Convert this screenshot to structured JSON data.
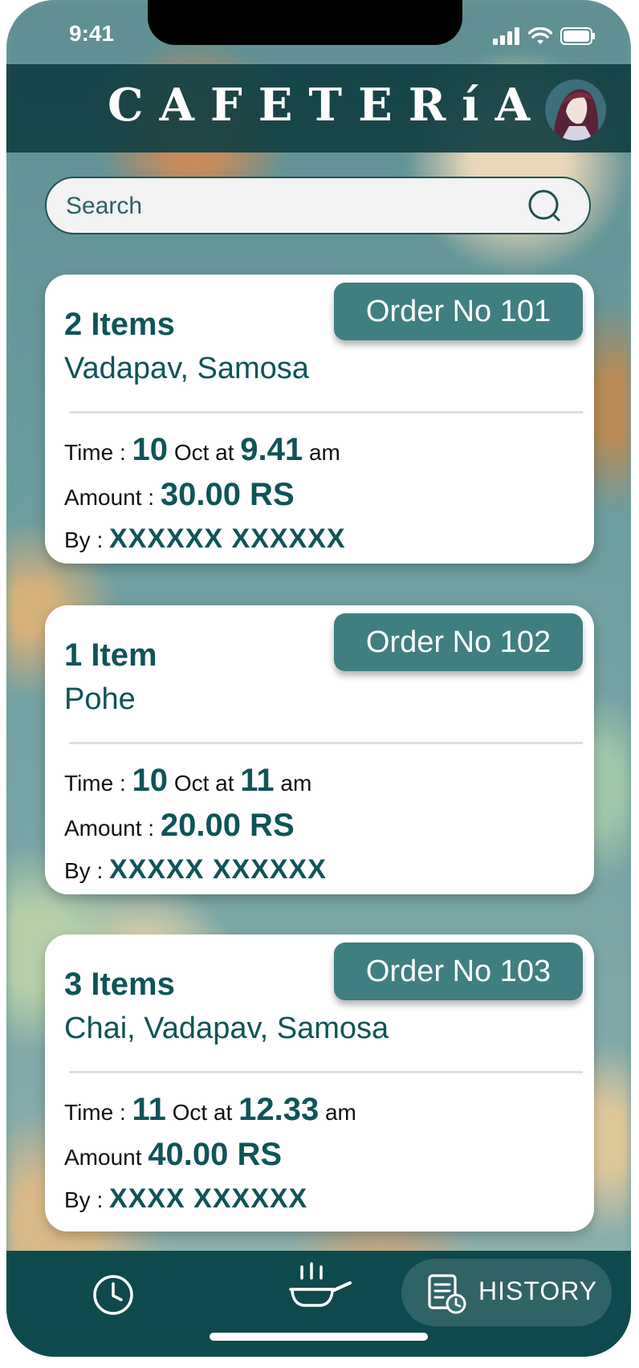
{
  "status_bar": {
    "time": "9:41"
  },
  "header": {
    "title": "CAFETERíA"
  },
  "search": {
    "placeholder": "Search"
  },
  "orders": [
    {
      "order_label": "Order No 101",
      "item_count": "2 Items",
      "items": "Vadapav, Samosa",
      "time_label": "Time :",
      "day": "10",
      "date_mid": "Oct at",
      "clock": "9.41",
      "period": "am",
      "amount_label": "Amount :",
      "amount": "30.00 RS",
      "by_label": "By :",
      "by": "XXXXXX XXXXXX"
    },
    {
      "order_label": "Order No 102",
      "item_count": "1 Item",
      "items": "Pohe",
      "time_label": "Time :",
      "day": "10",
      "date_mid": "Oct at",
      "clock": "11",
      "period": "am",
      "amount_label": "Amount :",
      "amount": "20.00 RS",
      "by_label": "By :",
      "by": "XXXXX XXXXXX"
    },
    {
      "order_label": "Order No 103",
      "item_count": "3 Items",
      "items": "Chai, Vadapav, Samosa",
      "time_label": "Time :",
      "day": "11",
      "date_mid": "Oct at",
      "clock": "12.33",
      "period": "am",
      "amount_label": "Amount",
      "amount": "40.00 RS",
      "by_label": "By :",
      "by": "XXXX XXXXXX"
    }
  ],
  "bottom_nav": {
    "history_label": "HISTORY"
  },
  "colors": {
    "brand_dark": "#0e4a4d",
    "accent": "#3f7f81",
    "text_teal": "#0f5458"
  },
  "icons": [
    "clock-icon",
    "cooking-pan-icon",
    "history-receipt-icon",
    "search-icon",
    "signal-icon",
    "wifi-icon",
    "battery-icon"
  ]
}
